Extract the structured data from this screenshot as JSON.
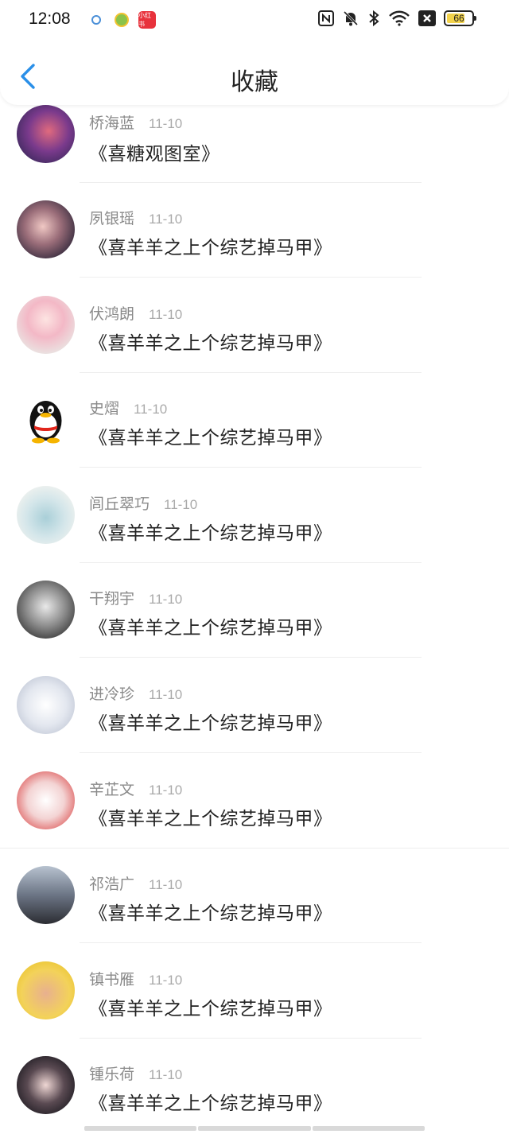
{
  "status_bar": {
    "time": "12:08",
    "notification_icons": [
      "settings-notif-icon",
      "smiley-app-icon",
      "red-app-icon"
    ],
    "red_app_label": "小红书",
    "battery_level": "66",
    "battery_color": "#f2d24a"
  },
  "nav": {
    "title": "收藏",
    "back_color": "#2a8fe8"
  },
  "items": [
    {
      "user": "桥海蓝",
      "date": "11-10",
      "title": "《喜糖观图室》"
    },
    {
      "user": "夙银瑶",
      "date": "11-10",
      "title": "《喜羊羊之上个综艺掉马甲》"
    },
    {
      "user": "伏鸿朗",
      "date": "11-10",
      "title": "《喜羊羊之上个综艺掉马甲》"
    },
    {
      "user": "史熠",
      "date": "11-10",
      "title": "《喜羊羊之上个综艺掉马甲》"
    },
    {
      "user": "闾丘翠巧",
      "date": "11-10",
      "title": "《喜羊羊之上个综艺掉马甲》"
    },
    {
      "user": "干翔宇",
      "date": "11-10",
      "title": "《喜羊羊之上个综艺掉马甲》"
    },
    {
      "user": "进冷珍",
      "date": "11-10",
      "title": "《喜羊羊之上个综艺掉马甲》"
    },
    {
      "user": "辛芷文",
      "date": "11-10",
      "title": "《喜羊羊之上个综艺掉马甲》"
    },
    {
      "user": "祁浩广",
      "date": "11-10",
      "title": "《喜羊羊之上个综艺掉马甲》"
    },
    {
      "user": "镇书雁",
      "date": "11-10",
      "title": "《喜羊羊之上个综艺掉马甲》"
    },
    {
      "user": "锺乐荷",
      "date": "11-10",
      "title": "《喜羊羊之上个综艺掉马甲》"
    }
  ]
}
